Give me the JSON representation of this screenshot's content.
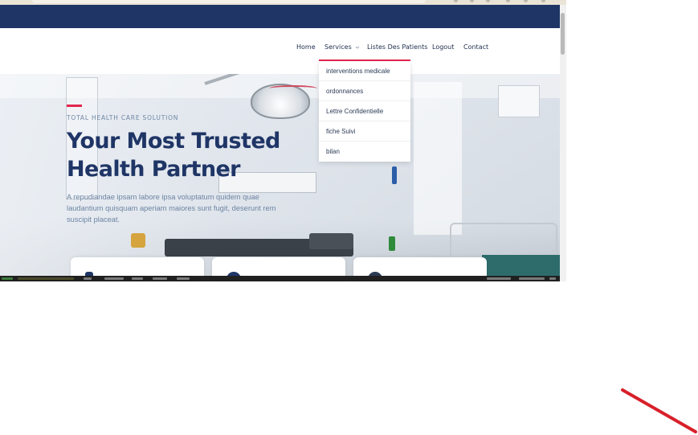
{
  "nav": {
    "items": [
      {
        "label": "Home"
      },
      {
        "label": "Services"
      },
      {
        "label": "Listes Des Patients"
      },
      {
        "label": "Logout"
      },
      {
        "label": "Contact"
      }
    ],
    "services_dropdown": [
      {
        "label": "interventions medicale"
      },
      {
        "label": "ordonnances"
      },
      {
        "label": "Lettre Confidentielle"
      },
      {
        "label": "fiche Suivi"
      },
      {
        "label": "bilan"
      }
    ]
  },
  "hero": {
    "eyebrow": "TOTAL HEALTH CARE SOLUTION",
    "title_line1": "Your Most Trusted",
    "title_line2": "Health Partner",
    "description": "A repudiandae ipsam labore ipsa voluptatum quidem quae laudantium quisquam aperiam maiores sunt fugit, deserunt rem suscipit placeat."
  },
  "colors": {
    "brand_navy": "#1f3566",
    "accent_red": "#e2264d",
    "muted_blue": "#6c84a3",
    "annotation_red": "#d8202a"
  },
  "icons": {
    "dropdown_chevron": "chevron-down-icon"
  }
}
